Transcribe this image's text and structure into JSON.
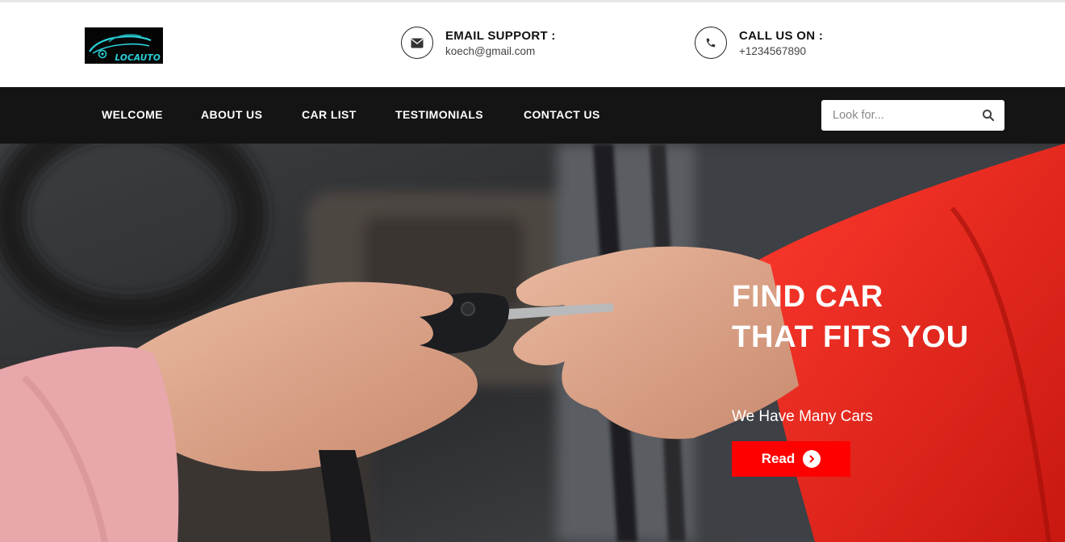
{
  "header": {
    "logo_text": "LOCAUTO",
    "email": {
      "title": "EMAIL SUPPORT :",
      "value": "koech@gmail.com",
      "icon": "envelope-icon"
    },
    "phone": {
      "title": "CALL US ON :",
      "value": "+1234567890",
      "icon": "phone-icon"
    }
  },
  "nav": {
    "items": [
      {
        "label": "WELCOME"
      },
      {
        "label": "ABOUT US"
      },
      {
        "label": "CAR LIST"
      },
      {
        "label": "TESTIMONIALS"
      },
      {
        "label": "CONTACT US"
      }
    ],
    "search": {
      "placeholder": "Look for...",
      "value": "",
      "icon": "search-icon"
    }
  },
  "hero": {
    "title": "FIND CAR THAT FITS YOU",
    "subtitle": "We Have Many Cars",
    "button_label": "Read",
    "button_icon": "chevron-right-icon"
  },
  "colors": {
    "accent": "#ff0000",
    "nav_bg": "#141414",
    "logo_text": "#2ad0d8"
  }
}
